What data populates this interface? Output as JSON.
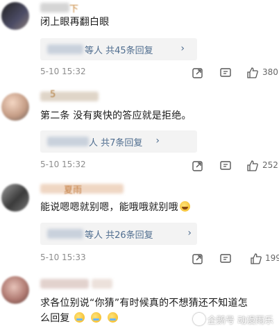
{
  "comments": [
    {
      "username_tail": "下",
      "text": "闭上眼再翻白眼",
      "reply_summary": "等人 共45条回复",
      "timestamp": "5-10 15:32",
      "likes": "380",
      "avatar_color": "#3a3a4a"
    },
    {
      "username_tail": "5",
      "text": "第二条 没有爽快的答应就是拒绝。",
      "reply_summary": "人 共7条回复",
      "timestamp": "5-10 15:32",
      "likes": "252",
      "avatar_color": "#c9a38a"
    },
    {
      "username_tail": "夏雨",
      "text": "能说嗯嗯就别嗯，能哦哦就别哦",
      "reply_summary": "等人 共26条回复",
      "timestamp": "5-10 15:33",
      "likes": "199",
      "avatar_color": "#5a5a5a"
    },
    {
      "username_tail": "",
      "text_line1": "求各位别说“你猜”有时候真的不想猜还不知道怎",
      "text_line2": "么回复",
      "timestamp": "",
      "likes": "",
      "avatar_color": "#b07a72"
    }
  ],
  "actions": {
    "share_icon": "share-icon",
    "comment_icon": "comment-icon",
    "like_icon": "thumbs-up-icon",
    "chevron": "›"
  },
  "watermark": {
    "text": "企鹅号 动漫雨乐"
  },
  "colors": {
    "link": "#4f6d8f",
    "timestamp": "#8c8c8c",
    "reply_bg": "#f3f3f3"
  }
}
